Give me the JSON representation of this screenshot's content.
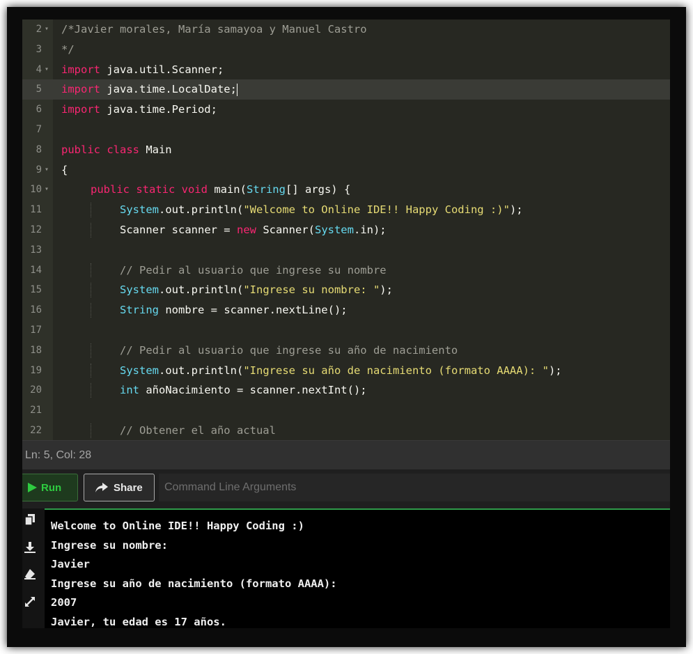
{
  "editor": {
    "lines": [
      {
        "n": "2",
        "fold": true,
        "indent": 0,
        "segs": [
          {
            "t": "/*Javier morales, María samayoa y Manuel Castro",
            "c": "cm"
          }
        ]
      },
      {
        "n": "3",
        "fold": false,
        "indent": 0,
        "segs": [
          {
            "t": "*/",
            "c": "cm"
          }
        ]
      },
      {
        "n": "4",
        "fold": true,
        "indent": 0,
        "segs": [
          {
            "t": "import",
            "c": "kw"
          },
          {
            "t": " java.util.Scanner;",
            "c": "fn"
          }
        ]
      },
      {
        "n": "5",
        "fold": false,
        "indent": 0,
        "active": true,
        "segs": [
          {
            "t": "import",
            "c": "kw"
          },
          {
            "t": " java.time.LocalDate;",
            "c": "fn"
          }
        ]
      },
      {
        "n": "6",
        "fold": false,
        "indent": 0,
        "segs": [
          {
            "t": "import",
            "c": "kw"
          },
          {
            "t": " java.time.Period;",
            "c": "fn"
          }
        ]
      },
      {
        "n": "7",
        "fold": false,
        "indent": 0,
        "segs": []
      },
      {
        "n": "8",
        "fold": false,
        "indent": 0,
        "segs": [
          {
            "t": "public class",
            "c": "kw"
          },
          {
            "t": " Main",
            "c": "fn"
          }
        ]
      },
      {
        "n": "9",
        "fold": true,
        "indent": 0,
        "segs": [
          {
            "t": "{",
            "c": "fn"
          }
        ]
      },
      {
        "n": "10",
        "fold": true,
        "indent": 1,
        "segs": [
          {
            "t": "public static void",
            "c": "kw"
          },
          {
            "t": " main(",
            "c": "fn"
          },
          {
            "t": "String",
            "c": "ty"
          },
          {
            "t": "[] args) {",
            "c": "fn"
          }
        ]
      },
      {
        "n": "11",
        "fold": false,
        "indent": 2,
        "segs": [
          {
            "t": "System",
            "c": "ty"
          },
          {
            "t": ".out.println(",
            "c": "fn"
          },
          {
            "t": "\"Welcome to Online IDE!! Happy Coding :)\"",
            "c": "st"
          },
          {
            "t": ");",
            "c": "fn"
          }
        ]
      },
      {
        "n": "12",
        "fold": false,
        "indent": 2,
        "segs": [
          {
            "t": "Scanner scanner = ",
            "c": "fn"
          },
          {
            "t": "new",
            "c": "kw"
          },
          {
            "t": " Scanner(",
            "c": "fn"
          },
          {
            "t": "System",
            "c": "ty"
          },
          {
            "t": ".in);",
            "c": "fn"
          }
        ]
      },
      {
        "n": "13",
        "fold": false,
        "indent": 0,
        "segs": []
      },
      {
        "n": "14",
        "fold": false,
        "indent": 2,
        "segs": [
          {
            "t": "// Pedir al usuario que ingrese su nombre",
            "c": "cm"
          }
        ]
      },
      {
        "n": "15",
        "fold": false,
        "indent": 2,
        "segs": [
          {
            "t": "System",
            "c": "ty"
          },
          {
            "t": ".out.println(",
            "c": "fn"
          },
          {
            "t": "\"Ingrese su nombre: \"",
            "c": "st"
          },
          {
            "t": ");",
            "c": "fn"
          }
        ]
      },
      {
        "n": "16",
        "fold": false,
        "indent": 2,
        "segs": [
          {
            "t": "String",
            "c": "ty"
          },
          {
            "t": " nombre = scanner.nextLine();",
            "c": "fn"
          }
        ]
      },
      {
        "n": "17",
        "fold": false,
        "indent": 0,
        "segs": []
      },
      {
        "n": "18",
        "fold": false,
        "indent": 2,
        "segs": [
          {
            "t": "// Pedir al usuario que ingrese su año de nacimiento",
            "c": "cm"
          }
        ]
      },
      {
        "n": "19",
        "fold": false,
        "indent": 2,
        "segs": [
          {
            "t": "System",
            "c": "ty"
          },
          {
            "t": ".out.println(",
            "c": "fn"
          },
          {
            "t": "\"Ingrese su año de nacimiento (formato AAAA): \"",
            "c": "st"
          },
          {
            "t": ");",
            "c": "fn"
          }
        ]
      },
      {
        "n": "20",
        "fold": false,
        "indent": 2,
        "segs": [
          {
            "t": "int",
            "c": "ty"
          },
          {
            "t": " añoNacimiento = scanner.nextInt();",
            "c": "fn"
          }
        ]
      },
      {
        "n": "21",
        "fold": false,
        "indent": 0,
        "segs": []
      },
      {
        "n": "22",
        "fold": false,
        "indent": 2,
        "segs": [
          {
            "t": "// Obtener el año actual",
            "c": "cm"
          }
        ]
      }
    ]
  },
  "status": {
    "position": "Ln: 5,  Col: 28"
  },
  "toolbar": {
    "run_label": "Run",
    "share_label": "Share",
    "args_placeholder": "Command Line Arguments"
  },
  "console": {
    "lines": [
      "Welcome to Online IDE!! Happy Coding :)",
      "Ingrese su nombre:",
      "Javier",
      "Ingrese su año de nacimiento (formato AAAA):",
      "2007",
      "Javier, tu edad es 17 años."
    ]
  },
  "icons": {
    "run": "play-icon",
    "share": "share-arrow-icon",
    "copy": "copy-icon",
    "download": "download-icon",
    "clear": "eraser-icon",
    "expand": "expand-icon"
  },
  "colors": {
    "keyword": "#f92672",
    "type": "#66d9ef",
    "string": "#e6db74",
    "comment": "#9e9e95",
    "run_green": "#2ecc40"
  }
}
